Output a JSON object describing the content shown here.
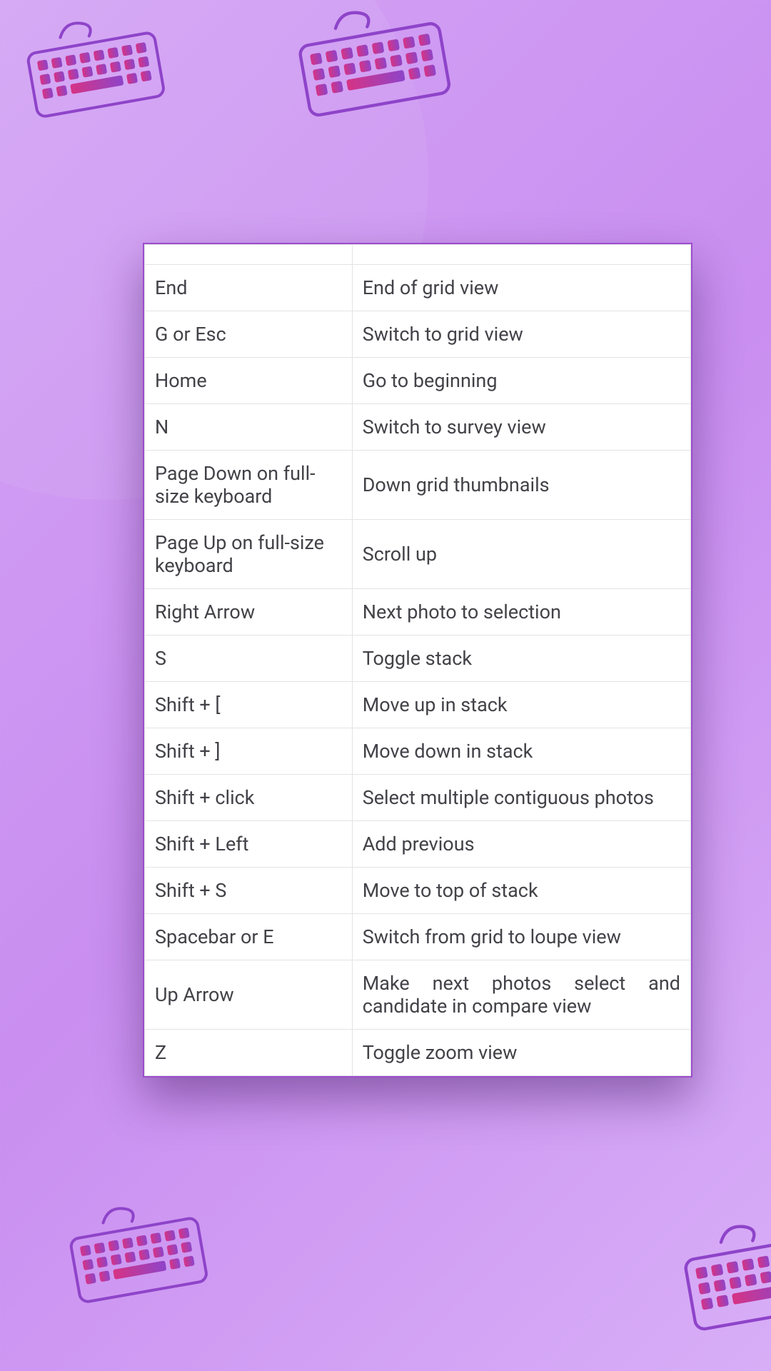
{
  "shortcuts": [
    {
      "key": "End",
      "action": "End of grid view"
    },
    {
      "key": "G or Esc",
      "action": "Switch to grid view"
    },
    {
      "key": "Home",
      "action": "Go to beginning"
    },
    {
      "key": "N",
      "action": "Switch to survey view"
    },
    {
      "key": "Page Down on full-size keyboard",
      "action": "Down grid thumbnails"
    },
    {
      "key": "Page Up on full-size keyboard",
      "action": "Scroll up"
    },
    {
      "key": "Right Arrow",
      "action": "Next photo to selection"
    },
    {
      "key": "S",
      "action": "Toggle stack"
    },
    {
      "key": "Shift + [",
      "action": "Move up in stack"
    },
    {
      "key": "Shift + ]",
      "action": "Move down in stack"
    },
    {
      "key": "Shift + click",
      "action": "Select multiple contiguous photos"
    },
    {
      "key": "Shift + Left",
      "action": "Add previous"
    },
    {
      "key": "Shift + S",
      "action": "Move to top of stack"
    },
    {
      "key": "Spacebar or E",
      "action": "Switch from grid to loupe view"
    },
    {
      "key": "Up Arrow",
      "action": "Make next photos select and candidate in compare view"
    },
    {
      "key": "Z",
      "action": "Toggle zoom view"
    }
  ],
  "justify_rows": [
    10,
    14
  ]
}
